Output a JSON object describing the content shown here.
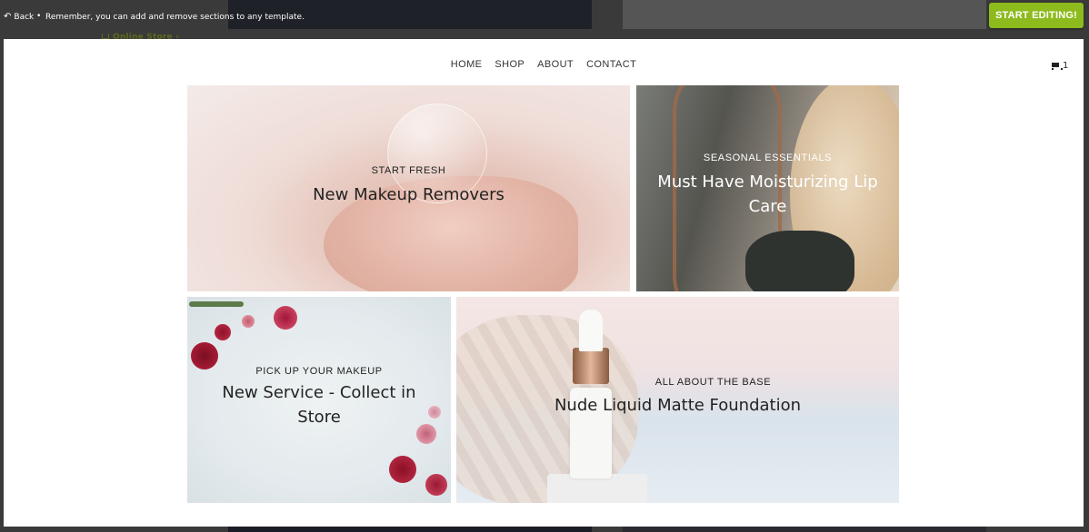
{
  "editor_bar": {
    "back_label": "Back",
    "separator": "•",
    "notice": "Remember, you can add and remove sections to any template.",
    "start_button": "START EDITING!",
    "accent_color": "#8dbb1e"
  },
  "background_page": {
    "store_link": "Online Store"
  },
  "preview": {
    "nav": {
      "items": [
        {
          "label": "HOME"
        },
        {
          "label": "SHOP"
        },
        {
          "label": "ABOUT"
        },
        {
          "label": "CONTACT"
        }
      ],
      "cart_count": "1"
    },
    "tiles": [
      {
        "eyebrow": "START FRESH",
        "headline": "New Makeup Removers"
      },
      {
        "eyebrow": "SEASONAL ESSENTIALS",
        "headline": "Must Have Moisturizing Lip Care"
      },
      {
        "eyebrow": "PICK UP YOUR MAKEUP",
        "headline": "New Service - Collect in Store"
      },
      {
        "eyebrow": "ALL ABOUT THE BASE",
        "headline": "Nude Liquid Matte Foundation"
      }
    ]
  }
}
